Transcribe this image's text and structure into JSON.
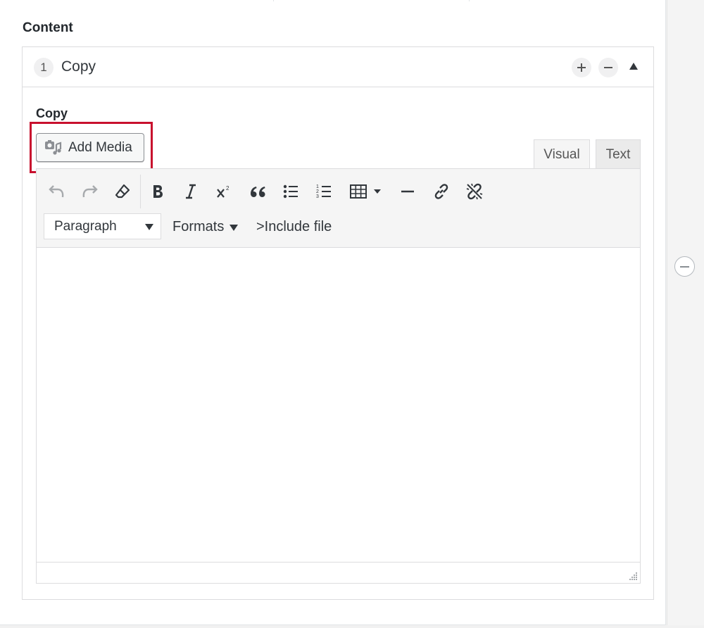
{
  "field": {
    "label": "Content"
  },
  "repeater": {
    "row_index": "1",
    "row_title": "Copy"
  },
  "subfield": {
    "label": "Copy"
  },
  "media": {
    "button_label": "Add Media"
  },
  "tabs": {
    "visual": "Visual",
    "text": "Text"
  },
  "toolbar": {
    "buttons": [
      "undo-icon",
      "redo-icon",
      "clear-formatting-icon",
      "bold-icon",
      "italic-icon",
      "superscript-icon",
      "blockquote-icon",
      "bulleted-list-icon",
      "numbered-list-icon",
      "table-icon",
      "horizontal-line-icon",
      "link-icon",
      "unlink-icon"
    ],
    "format_select": "Paragraph",
    "formats_label": "Formats",
    "include_file_label": ">Include file"
  },
  "colors": {
    "highlight": "#c8102e",
    "text": "#23282d",
    "toolbar_bg": "#f5f5f5",
    "border": "#dcdcde"
  }
}
